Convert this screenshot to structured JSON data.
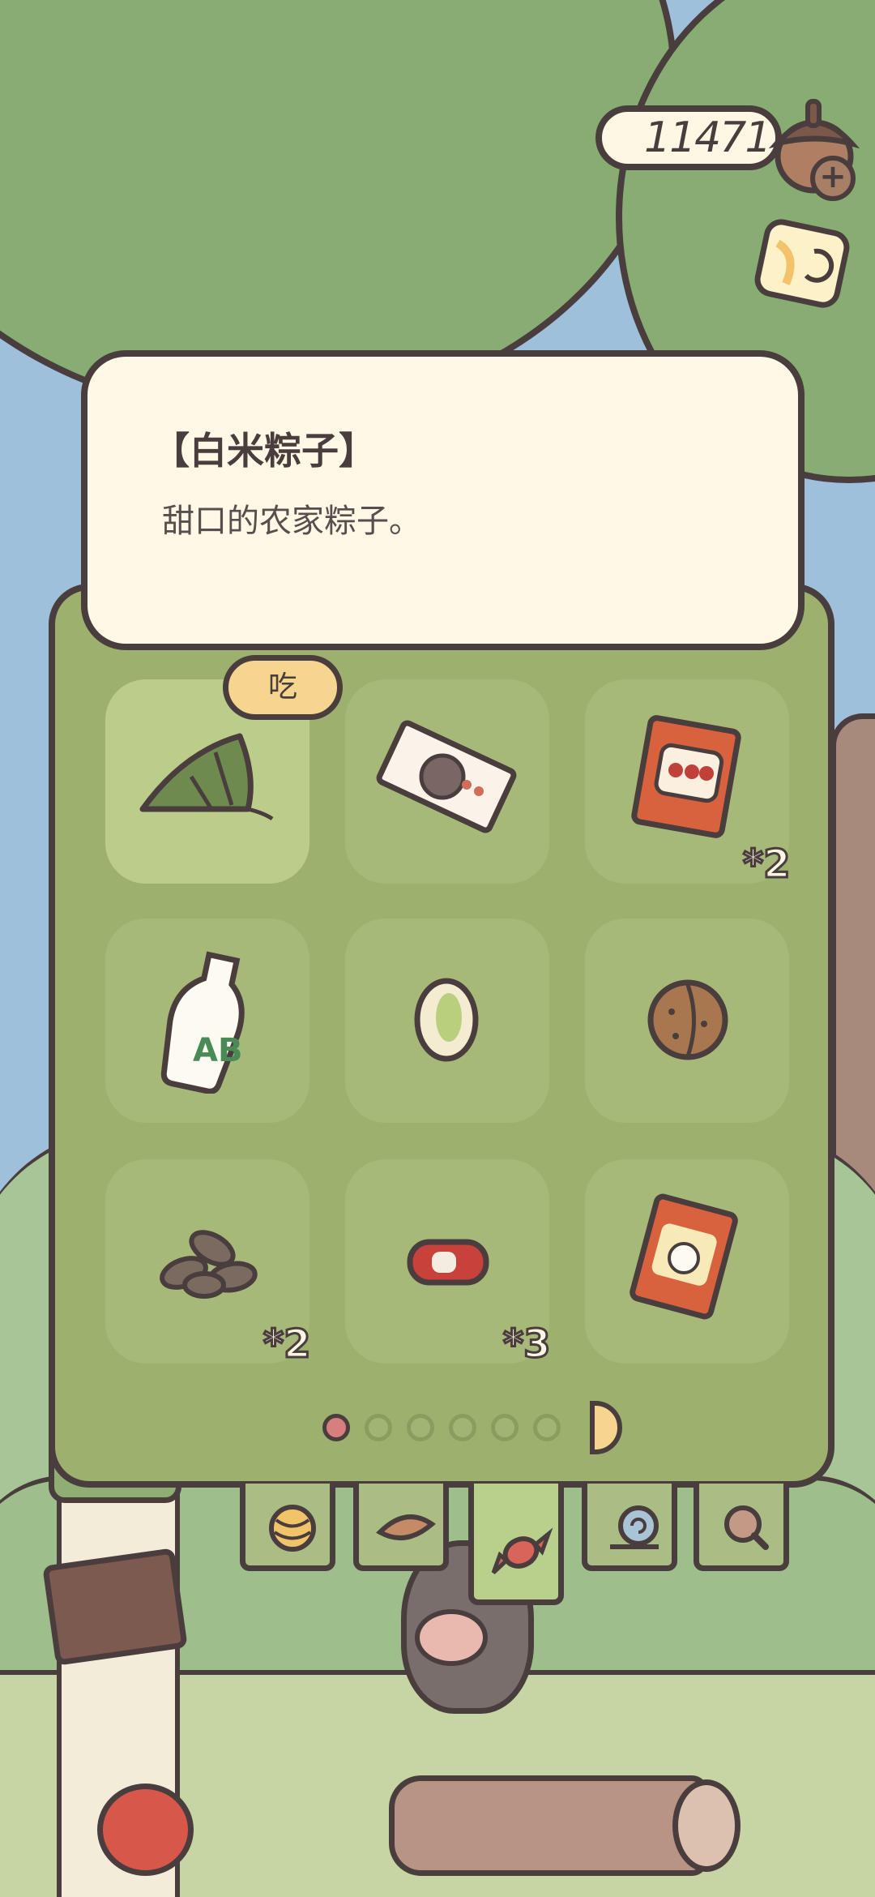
{
  "hud": {
    "coins": "11471",
    "acorn_icon": "acorn-icon",
    "add_icon": "plus-icon",
    "note_icon": "note-icon"
  },
  "tooltip": {
    "title": "【白米粽子】",
    "description": "甜口的农家粽子。"
  },
  "inventory": {
    "action_button": "吃",
    "items": [
      {
        "name": "zongzi-icon",
        "count": ""
      },
      {
        "name": "candy-pack-icon",
        "count": ""
      },
      {
        "name": "snack-bag-icon",
        "count": "*2"
      },
      {
        "name": "milk-bottle-icon",
        "count": ""
      },
      {
        "name": "pistachio-icon",
        "count": ""
      },
      {
        "name": "walnut-icon",
        "count": ""
      },
      {
        "name": "sunflower-seeds-icon",
        "count": "*2"
      },
      {
        "name": "soda-can-icon",
        "count": "*3"
      },
      {
        "name": "chips-bag-icon",
        "count": ""
      }
    ],
    "pages": {
      "total": 6,
      "current": 1
    }
  },
  "tabs": [
    {
      "name": "yarn-icon",
      "active": false
    },
    {
      "name": "leaf-icon",
      "active": false
    },
    {
      "name": "candy-icon",
      "active": true
    },
    {
      "name": "snail-icon",
      "active": false
    },
    {
      "name": "magnifier-icon",
      "active": false
    }
  ],
  "colors": {
    "outline": "#4a3d3d",
    "panel": "#9db06e",
    "tooltip_bg": "#fdf9e6",
    "button_yellow": "#f6d68e",
    "active_dot": "#d77e7e"
  }
}
